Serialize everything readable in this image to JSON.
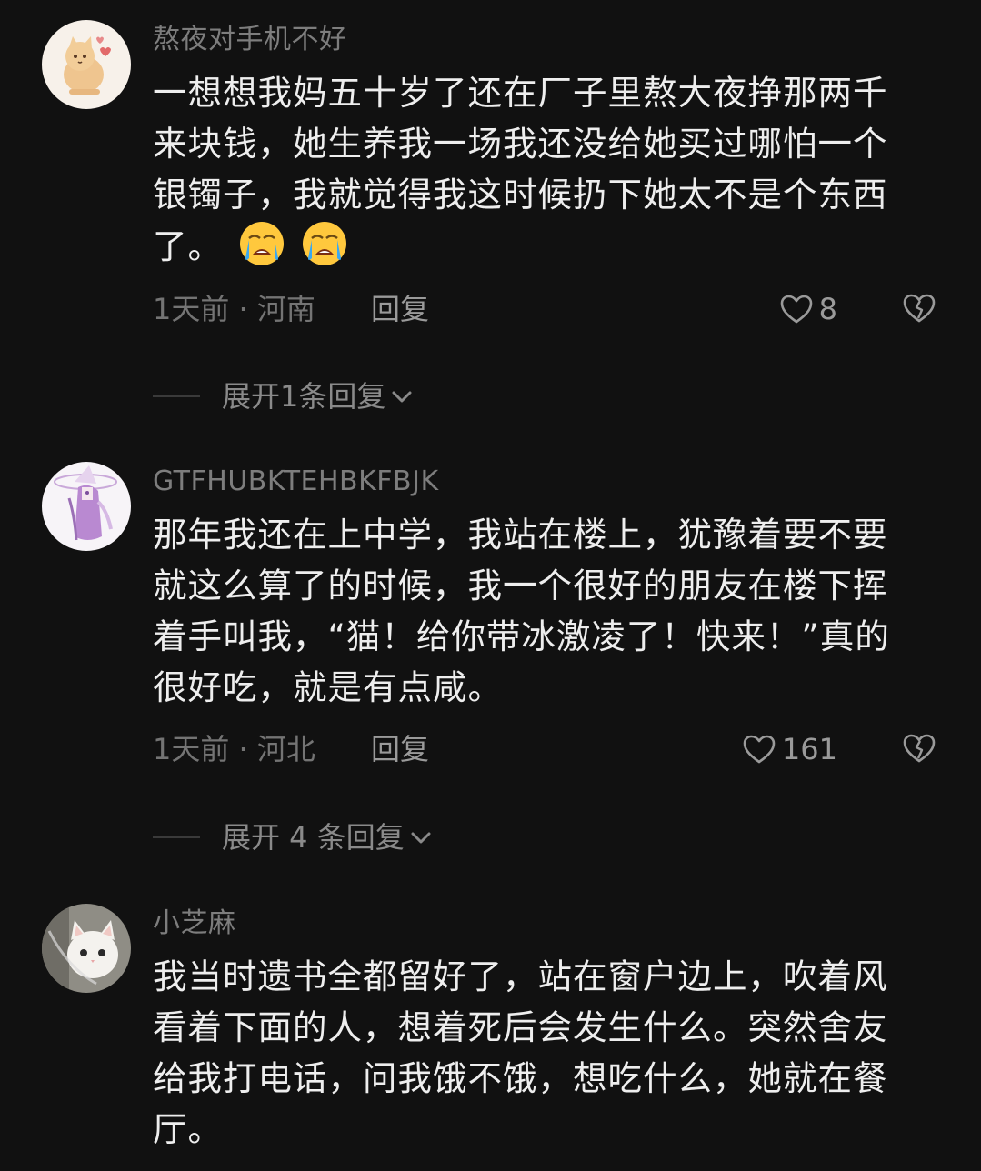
{
  "comments": [
    {
      "username": "熬夜对手机不好",
      "text": "一想想我妈五十岁了还在厂子里熬大夜挣那两千来块钱，她生养我一场我还没给她买过哪怕一个银镯子，我就觉得我这时候扔下她太不是个东西了。",
      "emojis": [
        "loudly-crying-face-emoji",
        "loudly-crying-face-emoji"
      ],
      "meta": "1天前 · 河南",
      "reply_label": "回复",
      "likes": "8",
      "expand_label": "展开1条回复"
    },
    {
      "username": "GTFHUBKTEHBKFBJK",
      "text": "那年我还在上中学，我站在楼上，犹豫着要不要就这么算了的时候，我一个很好的朋友在楼下挥着手叫我，“猫！给你带冰激凌了！快来！”真的很好吃，就是有点咸。",
      "meta": "1天前 · 河北",
      "reply_label": "回复",
      "likes": "161",
      "expand_label": "展开 4 条回复"
    },
    {
      "username": "小芝麻",
      "text": "我当时遗书全都留好了，站在窗户边上，吹着风看着下面的人，想着死后会发生什么。突然舍友给我打电话，问我饿不饿，想吃什么，她就在餐厅。"
    }
  ],
  "colors": {
    "background": "#111111",
    "text": "#eeeeee",
    "muted": "#7d7d7d"
  },
  "icons": [
    "heart-outline-icon",
    "broken-heart-icon",
    "chevron-down-icon"
  ]
}
